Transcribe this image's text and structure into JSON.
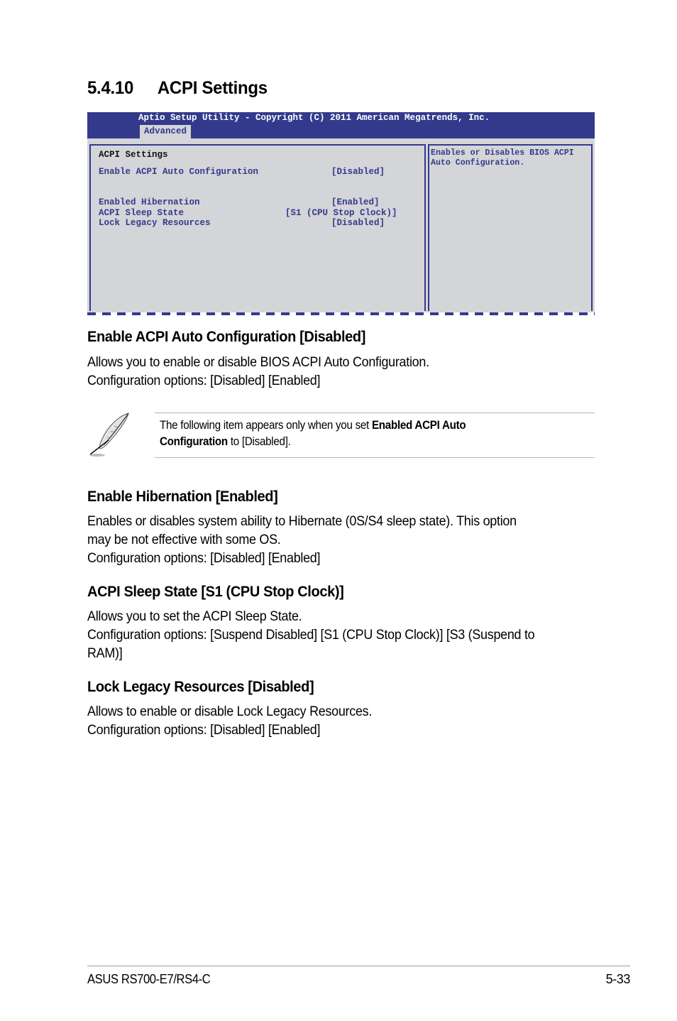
{
  "section": {
    "number": "5.4.10",
    "title": "ACPI Settings"
  },
  "bios": {
    "title_bar": "Aptio Setup Utility - Copyright (C) 2011 American Megatrends, Inc.",
    "active_tab": "Advanced",
    "heading": "ACPI Settings",
    "items": [
      {
        "label": "Enable ACPI Auto Configuration",
        "value": "[Disabled]"
      },
      {
        "label": "Enabled Hibernation",
        "value": "[Enabled]"
      },
      {
        "label": "ACPI Sleep State",
        "value": "[S1 (CPU Stop Clock)]"
      },
      {
        "label": "Lock Legacy Resources",
        "value": "[Disabled]"
      }
    ],
    "help_text": "Enables or Disables BIOS ACPI\nAuto Configuration.",
    "colors": {
      "frame": "#333a8c",
      "panel": "#d4d5d8"
    }
  },
  "options": [
    {
      "heading": "Enable ACPI Auto Configuration [Disabled]",
      "lines": [
        "Allows you to enable or disable BIOS ACPI Auto Configuration.",
        "Configuration options: [Disabled] [Enabled]"
      ]
    },
    {
      "heading": "Enable Hibernation [Enabled]",
      "lines": [
        "Enables or disables system ability to Hibernate (0S/S4 sleep state). This option",
        "may be not effective with some OS.",
        "Configuration options: [Disabled] [Enabled]"
      ]
    },
    {
      "heading": "ACPI Sleep State [S1 (CPU Stop Clock)]",
      "lines": [
        "Allows you to set the ACPI Sleep State.",
        "Configuration options: [Suspend Disabled] [S1 (CPU Stop Clock)] [S3 (Suspend to",
        "RAM)]"
      ]
    },
    {
      "heading": "Lock Legacy Resources [Disabled]",
      "lines": [
        "Allows to enable or disable Lock Legacy Resources.",
        "Configuration options: [Disabled] [Enabled]"
      ]
    }
  ],
  "note": {
    "icon": "feather-pen-icon",
    "text_before": "The following item appears only when you set ",
    "bold_1": "Enabled ACPI Auto",
    "bold_2": "Configuration",
    "text_after": " to [Disabled]."
  },
  "footer": {
    "product": "ASUS RS700-E7/RS4-C",
    "page": "5-33"
  }
}
